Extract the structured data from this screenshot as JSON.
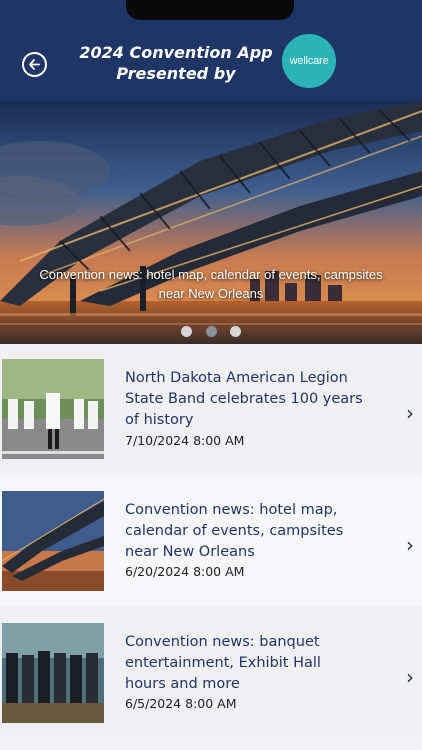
{
  "header": {
    "title_line1": "2024 Convention App",
    "title_line2": "Presented by",
    "brand_logo_text": "wellcare",
    "back_icon": "back-arrow-icon"
  },
  "hero": {
    "caption_line1": "Convention news: hotel map, calendar of events, campsites",
    "caption_line2": "near New Orleans",
    "slide_count": 3,
    "active_slide": 2
  },
  "news": [
    {
      "title": "North Dakota American Legion State Band celebrates 100 years of history",
      "date": "7/10/2024 8:00 AM"
    },
    {
      "title": "Convention news: hotel map, calendar of events, campsites near New Orleans",
      "date": "6/20/2024 8:00 AM"
    },
    {
      "title": "Convention news: banquet entertainment, Exhibit Hall hours and more",
      "date": "6/5/2024 8:00 AM"
    }
  ],
  "colors": {
    "header_bg": "#1e3566",
    "brand": "#2bb3b8",
    "title_text": "#1f3566"
  }
}
